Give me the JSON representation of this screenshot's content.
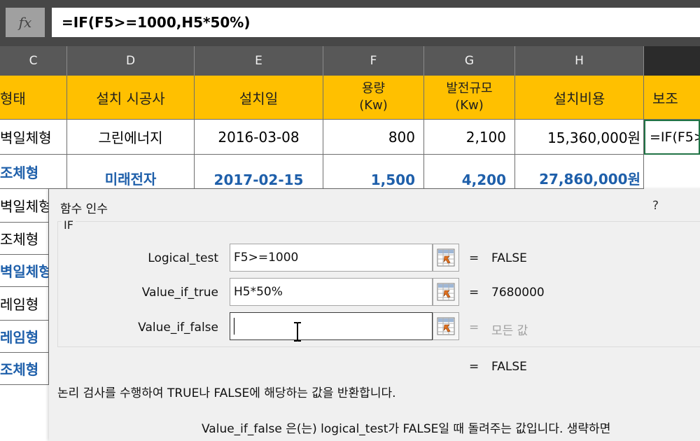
{
  "formula_bar": {
    "fx_label": "fx",
    "formula": "=IF(F5>=1000,H5*50%)"
  },
  "columns": [
    "C",
    "D",
    "E",
    "F",
    "G",
    "H",
    ""
  ],
  "table": {
    "headers": {
      "c": "형태",
      "d": "설치 시공사",
      "e": "설치일",
      "f_line1": "용량",
      "f_line2": "(Kw)",
      "g_line1": "발전규모",
      "g_line2": "(Kw)",
      "h": "설치비용",
      "i": "보조"
    },
    "row1": {
      "c": "벽일체형",
      "d": "그린에너지",
      "e": "2016-03-08",
      "f": "800",
      "g": "2,100",
      "h": "15,360,000원",
      "i": "=IF(F5>"
    },
    "row2": {
      "c": "조체형",
      "d": "미래전자",
      "e": "2017-02-15",
      "f": "1,500",
      "g": "4,200",
      "h": "27,860,000원"
    },
    "col_c_rows": [
      "벽일체형",
      "조체형",
      "벽일체형",
      "레임형",
      "레임형",
      "조체형"
    ]
  },
  "dialog": {
    "title": "함수 인수",
    "help": "?",
    "group_label": "IF",
    "args": [
      {
        "label": "Logical_test",
        "value": "F5>=1000",
        "eq": "=",
        "result": "FALSE"
      },
      {
        "label": "Value_if_true",
        "value": "H5*50%",
        "eq": "=",
        "result": "7680000"
      },
      {
        "label": "Value_if_false",
        "value": "",
        "eq": "=",
        "result": "모든 값"
      }
    ],
    "overall_eq": "=",
    "overall_result": "FALSE",
    "description": "논리 검사를 수행하여 TRUE나 FALSE에 해당하는 값을 반환합니다.",
    "arg_description": "Value_if_false  은(는) logical_test가 FALSE일 때 돌려주는 값입니다. 생략하면"
  }
}
